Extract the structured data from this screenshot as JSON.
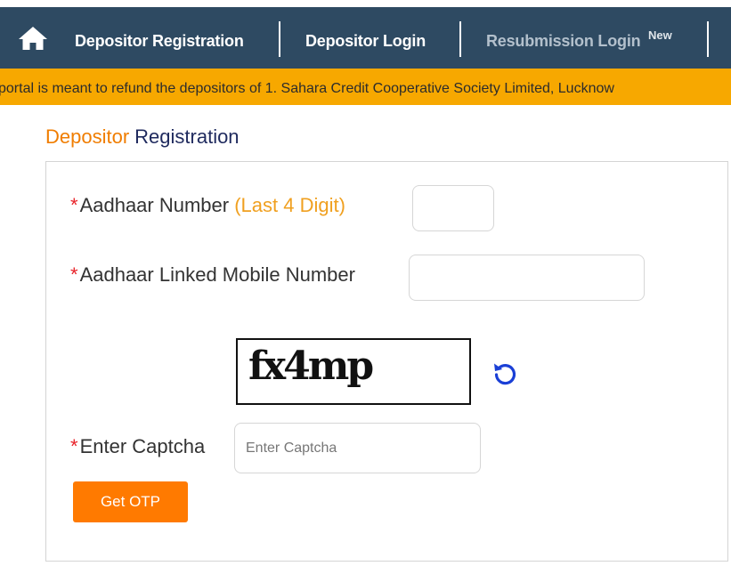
{
  "nav": {
    "items": [
      {
        "label": "Depositor Registration"
      },
      {
        "label": "Depositor Login"
      },
      {
        "label": "Resubmission Login",
        "badge": "New"
      }
    ]
  },
  "ticker": {
    "text": "portal is meant to refund the depositors of 1. Sahara Credit Cooperative Society Limited, Lucknow"
  },
  "page": {
    "title_part1": "Depositor",
    "title_part2": "Registration"
  },
  "form": {
    "required_mark": "*",
    "aadhaar_label": "Aadhaar Number",
    "aadhaar_hint": "(Last 4 Digit)",
    "aadhaar_value": "",
    "mobile_label": "Aadhaar Linked Mobile Number",
    "mobile_value": "",
    "captcha_image_text": "fx4mp",
    "captcha_label": "Enter Captcha",
    "captcha_placeholder": "Enter Captcha",
    "submit_label": "Get OTP"
  },
  "colors": {
    "navbar": "#2e4a62",
    "ticker": "#f7a800",
    "accent_orange": "#f07d00",
    "button": "#ff7a00",
    "refresh_icon": "#1a3fd6"
  }
}
